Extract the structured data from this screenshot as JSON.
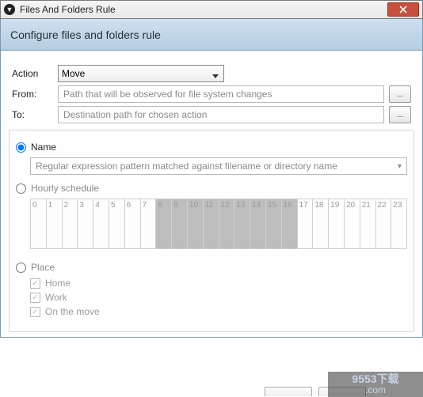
{
  "window": {
    "title": "Files And Folders Rule"
  },
  "header": {
    "title": "Configure files and folders rule"
  },
  "rows": {
    "action_label": "Action",
    "action_value": "Move",
    "from_label": "From:",
    "from_placeholder": "Path that will be observed for file system changes",
    "to_label": "To:",
    "to_placeholder": "Destination path for chosen action",
    "browse_label": "..."
  },
  "radios": {
    "name_label": "Name",
    "name_placeholder": "Regular expression pattern matched against filename or directory name",
    "hourly_label": "Hourly schedule",
    "place_label": "Place",
    "selected": "name"
  },
  "hours": {
    "labels": [
      "0",
      "1",
      "2",
      "3",
      "4",
      "5",
      "6",
      "7",
      "8",
      "9",
      "10",
      "11",
      "12",
      "13",
      "14",
      "15",
      "16",
      "17",
      "18",
      "19",
      "20",
      "21",
      "22",
      "23"
    ],
    "selected_start": 8,
    "selected_end": 16
  },
  "places": {
    "home": "Home",
    "work": "Work",
    "move": "On the move"
  },
  "watermark": {
    "line1": "9553下载",
    "line2": ".com"
  }
}
